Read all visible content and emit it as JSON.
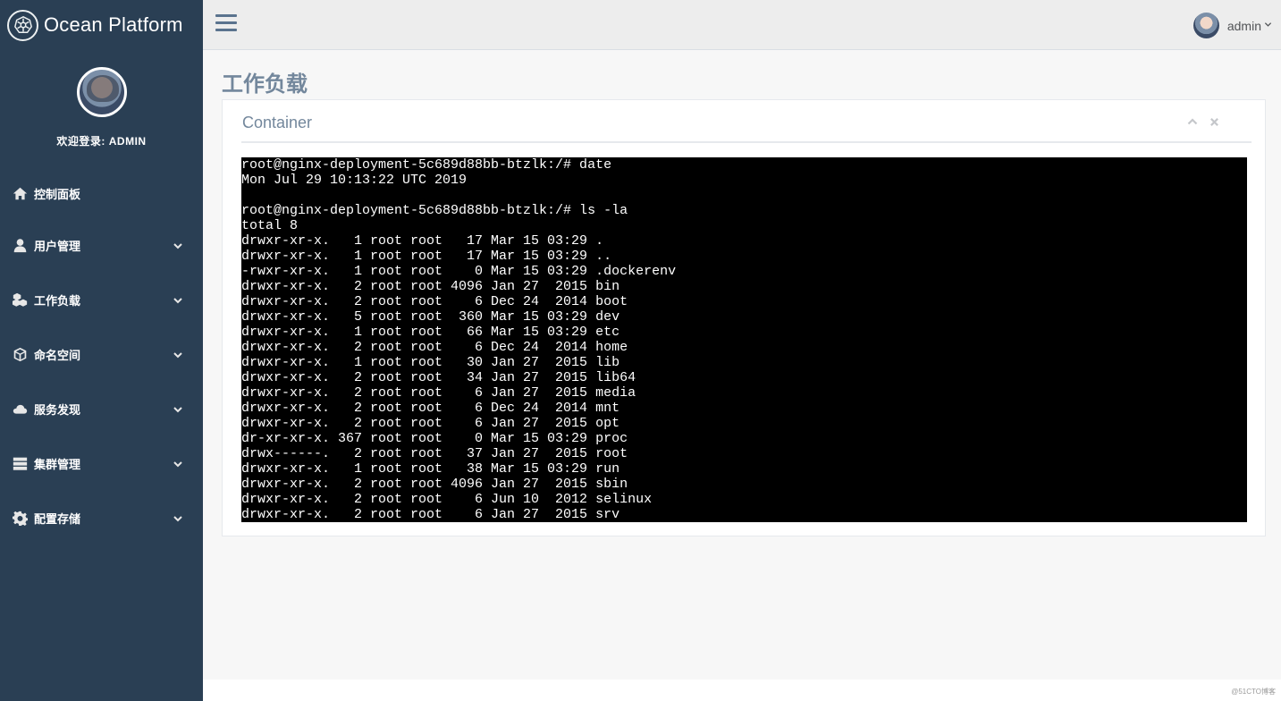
{
  "brand": {
    "title": "Ocean Platform",
    "logo_icon": "kubernetes-wheel-icon"
  },
  "profile": {
    "welcome": "欢迎登录: ADMIN"
  },
  "sidebar": {
    "items": [
      {
        "label": "控制面板",
        "icon": "home-icon"
      },
      {
        "label": "用户管理",
        "icon": "user-icon"
      },
      {
        "label": "工作负载",
        "icon": "cubes-icon"
      },
      {
        "label": "命名空间",
        "icon": "cube-icon"
      },
      {
        "label": "服务发现",
        "icon": "cloud-icon"
      },
      {
        "label": "集群管理",
        "icon": "server-icon"
      },
      {
        "label": "配置存储",
        "icon": "gear-icon"
      }
    ]
  },
  "topnav": {
    "user": "admin"
  },
  "page": {
    "title": "工作负载"
  },
  "panel": {
    "title": "Container"
  },
  "terminal": {
    "lines": [
      "root@nginx-deployment-5c689d88bb-btzlk:/# date",
      "Mon Jul 29 10:13:22 UTC 2019",
      "",
      "root@nginx-deployment-5c689d88bb-btzlk:/# ls -la",
      "total 8",
      "drwxr-xr-x.   1 root root   17 Mar 15 03:29 .",
      "drwxr-xr-x.   1 root root   17 Mar 15 03:29 ..",
      "-rwxr-xr-x.   1 root root    0 Mar 15 03:29 .dockerenv",
      "drwxr-xr-x.   2 root root 4096 Jan 27  2015 bin",
      "drwxr-xr-x.   2 root root    6 Dec 24  2014 boot",
      "drwxr-xr-x.   5 root root  360 Mar 15 03:29 dev",
      "drwxr-xr-x.   1 root root   66 Mar 15 03:29 etc",
      "drwxr-xr-x.   2 root root    6 Dec 24  2014 home",
      "drwxr-xr-x.   1 root root   30 Jan 27  2015 lib",
      "drwxr-xr-x.   2 root root   34 Jan 27  2015 lib64",
      "drwxr-xr-x.   2 root root    6 Jan 27  2015 media",
      "drwxr-xr-x.   2 root root    6 Dec 24  2014 mnt",
      "drwxr-xr-x.   2 root root    6 Jan 27  2015 opt",
      "dr-xr-xr-x. 367 root root    0 Mar 15 03:29 proc",
      "drwx------.   2 root root   37 Jan 27  2015 root",
      "drwxr-xr-x.   1 root root   38 Mar 15 03:29 run",
      "drwxr-xr-x.   2 root root 4096 Jan 27  2015 sbin",
      "drwxr-xr-x.   2 root root    6 Jun 10  2012 selinux",
      "drwxr-xr-x.   2 root root    6 Jan 27  2015 srv"
    ]
  },
  "footer": {
    "watermark": "@51CTO博客"
  },
  "colors": {
    "sidebar": "#2a3f54",
    "topnav": "#ededed",
    "title": "#73879c",
    "terminal_bg": "#000000"
  }
}
